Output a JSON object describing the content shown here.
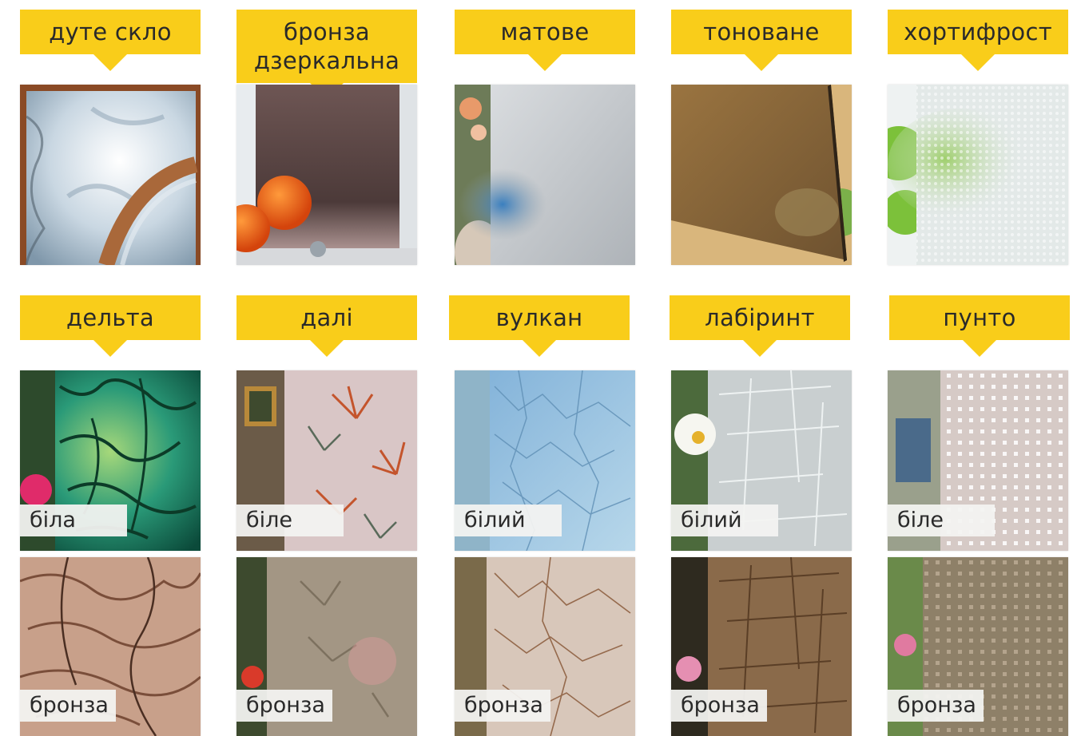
{
  "row1": [
    {
      "label": "дуте скло"
    },
    {
      "label_line1": "бронза",
      "label_line2": "дзеркальна"
    },
    {
      "label": "матове"
    },
    {
      "label": "тоноване"
    },
    {
      "label": "хортифрост"
    }
  ],
  "row2": [
    {
      "label": "дельта",
      "white": "біла",
      "bronze": "бронза"
    },
    {
      "label": "далі",
      "white": "біле",
      "bronze": "бронза"
    },
    {
      "label": "вулкан",
      "white": "білий",
      "bronze": "бронза"
    },
    {
      "label": "лабіринт",
      "white": "білий",
      "bronze": "бронза"
    },
    {
      "label": "пунто",
      "white": "біле",
      "bronze": "бронза"
    }
  ],
  "colors": {
    "accent": "#f9cd1a",
    "text": "#2a2a2a"
  }
}
